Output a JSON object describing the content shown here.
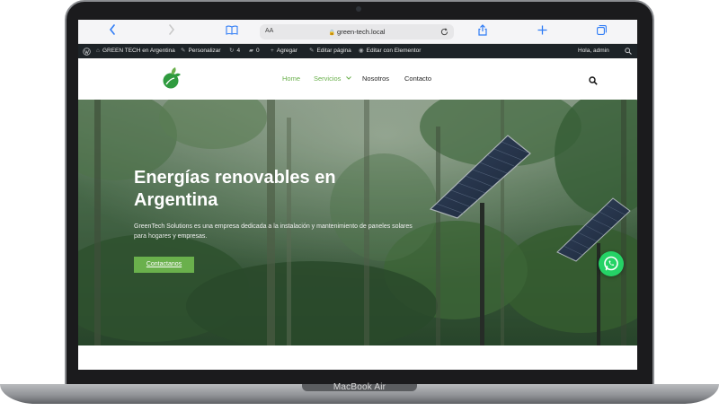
{
  "laptop": {
    "model_label": "MacBook Air"
  },
  "browser": {
    "aa_label": "AA",
    "url": "green-tech.local",
    "icons": [
      "chevron-left-icon",
      "chevron-right-icon",
      "book-icon",
      "lock-icon",
      "reload-icon",
      "share-icon",
      "plus-icon",
      "tabs-icon"
    ]
  },
  "admin_bar": {
    "site_name": "GREEN TECH en Argentina",
    "customize": "Personalizar",
    "updates_count": "4",
    "comments_count": "0",
    "new_label": "Agregar",
    "edit_page": "Editar página",
    "edit_elementor": "Editar con Elementor",
    "greeting": "Hola, admin"
  },
  "nav": {
    "items": [
      {
        "label": "Home",
        "active": true
      },
      {
        "label": "Servicios",
        "active": true,
        "has_dropdown": true
      },
      {
        "label": "Nosotros",
        "active": false
      },
      {
        "label": "Contacto",
        "active": false
      }
    ]
  },
  "hero": {
    "title": "Energías renovables en Argentina",
    "description": "GreenTech Solutions es una empresa dedicada a la instalación y mantenimiento de paneles solares para hogares y empresas.",
    "cta_label": "Contactanos"
  },
  "colors": {
    "accent": "#6ab04c",
    "admin_bar": "#1d2327",
    "safari_bar": "#f5f5f7",
    "safari_blue": "#2f7cf6",
    "whatsapp": "#25d366"
  }
}
